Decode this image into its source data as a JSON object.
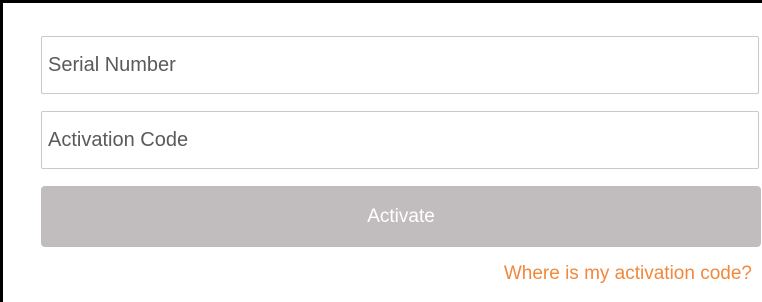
{
  "form": {
    "serial_number": {
      "placeholder": "Serial Number",
      "value": ""
    },
    "activation_code": {
      "placeholder": "Activation Code",
      "value": ""
    },
    "activate_label": "Activate",
    "help_link_label": "Where is my activation code?"
  },
  "colors": {
    "button_disabled_bg": "#c1bdbf",
    "button_text": "#ffffff",
    "link_accent": "#f2883c",
    "field_border": "#c9c9c9"
  }
}
